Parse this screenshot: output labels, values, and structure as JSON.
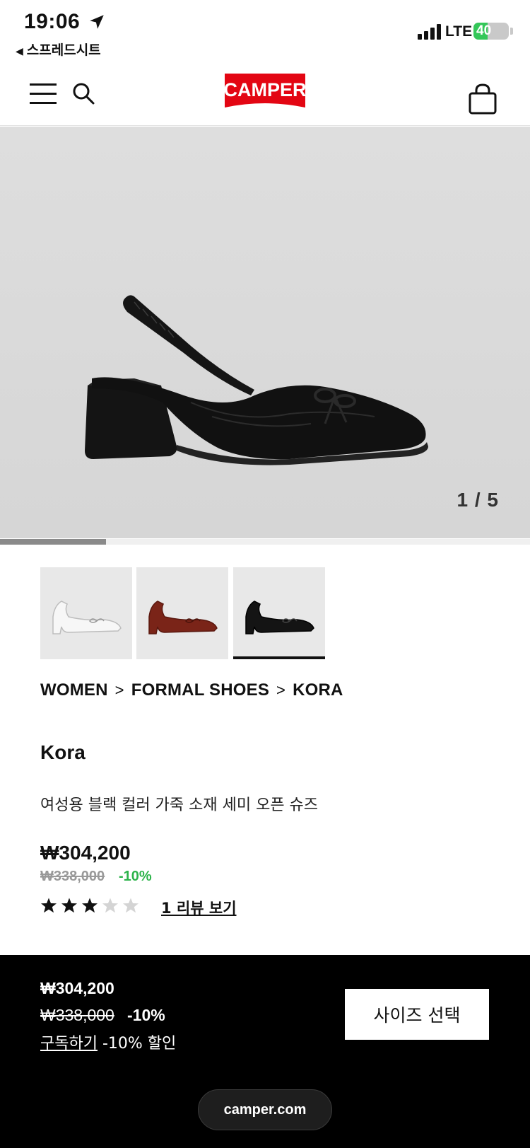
{
  "status_bar": {
    "time": "19:06",
    "back_app": "스프레드시트",
    "network": "LTE",
    "battery": "40",
    "battery_level": 0.4
  },
  "header": {
    "logo": "CAMPER"
  },
  "hero": {
    "counter": "1 / 5",
    "progress": 0.2
  },
  "thumbnails": [
    {
      "color": "white",
      "selected": false
    },
    {
      "color": "brown",
      "selected": false
    },
    {
      "color": "black",
      "selected": true
    }
  ],
  "breadcrumb": {
    "items": [
      "WOMEN",
      "FORMAL SHOES",
      "KORA"
    ],
    "separator": ">"
  },
  "product": {
    "name": "Kora",
    "description": "여성용 블랙 컬러 가죽 소재 세미 오픈 슈즈",
    "price": "₩304,200",
    "original_price": "₩338,000",
    "discount": "-10%",
    "rating": 3,
    "rating_max": 5,
    "review_link": "1 리뷰 보기"
  },
  "bottom_bar": {
    "price": "₩304,200",
    "original_price": "₩338,000",
    "discount": "-10%",
    "subscribe_link": "구독하기",
    "subscribe_text": "-10% 할인",
    "size_button": "사이즈 선택",
    "url": "camper.com"
  },
  "colors": {
    "brand_red": "#e30613",
    "discount_green": "#2cb34a",
    "bottom_bar_bg": "#000000"
  }
}
